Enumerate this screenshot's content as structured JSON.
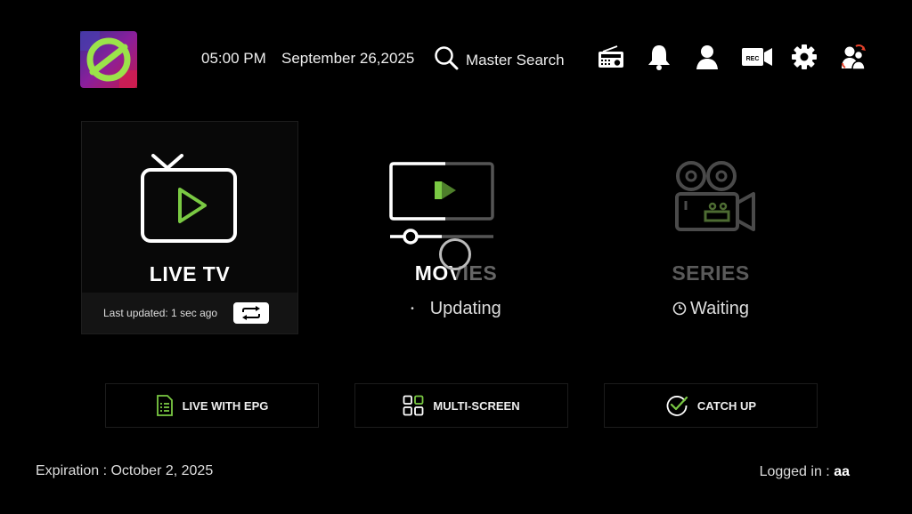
{
  "header": {
    "time": "05:00 PM",
    "date": "September 26,2025",
    "search_label": "Master Search",
    "icons": [
      "radio-icon",
      "bell-icon",
      "user-icon",
      "rec-icon",
      "gear-icon",
      "switch-user-icon"
    ],
    "rec_text": "REC"
  },
  "cards": {
    "live": {
      "title": "LIVE TV",
      "last_updated": "Last updated: 1 sec ago"
    },
    "movies": {
      "title": "MOVIES",
      "status": "Updating"
    },
    "series": {
      "title": "SERIES",
      "status": "Waiting"
    }
  },
  "buttons": {
    "epg": "LIVE WITH EPG",
    "multi": "MULTI-SCREEN",
    "catchup": "CATCH UP"
  },
  "footer": {
    "expiration": "Expiration : October 2, 2025",
    "logged_prefix": "Logged in :",
    "logged_user": "aa"
  },
  "colors": {
    "accent": "#7ac943",
    "background": "#000000",
    "card": "#080808"
  }
}
